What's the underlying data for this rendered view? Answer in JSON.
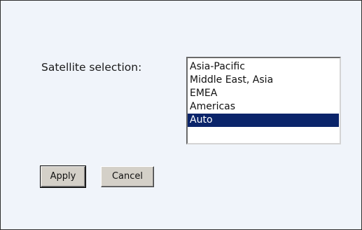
{
  "form": {
    "satellite_label": "Satellite selection:",
    "options": [
      {
        "label": "Asia-Pacific",
        "selected": false
      },
      {
        "label": "Middle East, Asia",
        "selected": false
      },
      {
        "label": "EMEA",
        "selected": false
      },
      {
        "label": "Americas",
        "selected": false
      },
      {
        "label": "Auto",
        "selected": true
      }
    ],
    "apply_label": "Apply",
    "cancel_label": "Cancel"
  },
  "colors": {
    "background": "#f0f4fa",
    "selection_highlight": "#0a246a",
    "button_face": "#d4d0c8"
  }
}
